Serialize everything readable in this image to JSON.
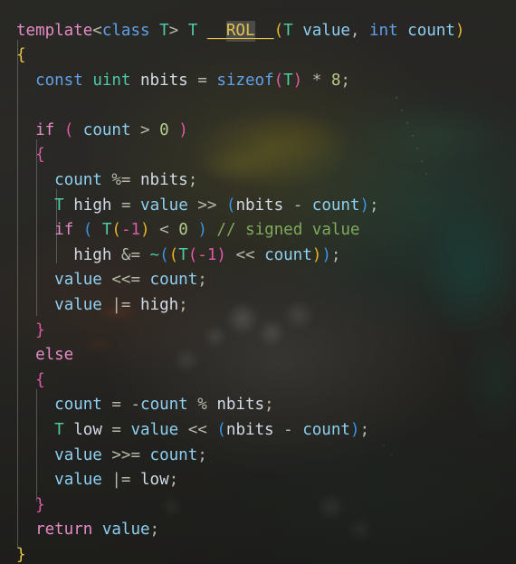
{
  "editor": {
    "language": "cpp",
    "function_name": "__ROL__",
    "highlighted_token": "ROL",
    "background_wallpaper": "dimmed-photo-koi-and-flowers",
    "indent_guides_visible": true,
    "rainbow_brackets": true
  },
  "theme": {
    "background": "#2d2d2a",
    "default_text": "#c8d3e0",
    "keyword": "#e58bc6",
    "keyword_blue": "#61a0e8",
    "type": "#4ec9a6",
    "variable": "#8ed0f2",
    "plain_identifier": "#d2dbe6",
    "number": "#b6cc8e",
    "operator": "#b4b9a8",
    "comment": "#7faa5c",
    "function": "#e4c44c",
    "bracket_level1": "#e8c547",
    "bracket_level2": "#e058a8",
    "bracket_level3": "#3a93e0",
    "bracket_level4": "#e8b227",
    "indent_guide": "rgba(160,160,160,0.42)",
    "occurrence_highlight": "rgba(160,160,160,0.30)"
  },
  "code": {
    "lines": [
      "template<class T> T __ROL__(T value, int count)",
      "{",
      "  const uint nbits = sizeof(T) * 8;",
      "",
      "  if ( count > 0 )",
      "  {",
      "    count %= nbits;",
      "    T high = value >> (nbits - count);",
      "    if ( T(-1) < 0 ) // signed value",
      "      high &= ~((T(-1) << count));",
      "    value <<= count;",
      "    value |= high;",
      "  }",
      "  else",
      "  {",
      "    count = -count % nbits;",
      "    T low = value << (nbits - count);",
      "    value >>= count;",
      "    value |= low;",
      "  }",
      "  return value;",
      "}"
    ],
    "comment_text": "// signed value",
    "line_count": 22
  },
  "tokens": {
    "template": "template",
    "class": "class",
    "const": "const",
    "uint": "uint",
    "sizeof": "sizeof",
    "int": "int",
    "if": "if",
    "else": "else",
    "return": "return",
    "type_T": "T",
    "var_value": "value",
    "var_count": "count",
    "var_nbits": "nbits",
    "var_high": "high",
    "var_low": "low",
    "literal_8": "8",
    "literal_0": "0",
    "literal_minus1": "-1"
  }
}
